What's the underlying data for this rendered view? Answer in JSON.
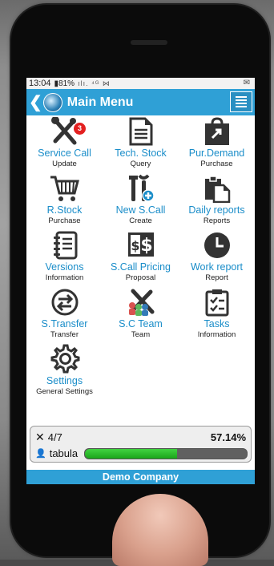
{
  "status_bar": {
    "time": "13:04",
    "battery": "81%",
    "signal_icons": "ılı. ⁴ᴳ ⋈",
    "mail_icon": "mail-icon"
  },
  "header": {
    "title": "Main Menu",
    "back_icon": "back-chevron-icon",
    "logo_icon": "globe-icon",
    "menu_icon": "menu-icon",
    "color": "#2fa0d6"
  },
  "tiles": [
    {
      "label": "Service Call",
      "sub": "Update",
      "icon": "tools-icon",
      "badge": "3"
    },
    {
      "label": "Tech. Stock",
      "sub": "Query",
      "icon": "document-icon"
    },
    {
      "label": "Pur.Demand",
      "sub": "Purchase",
      "icon": "shopping-bag-icon"
    },
    {
      "label": "R.Stock",
      "sub": "Purchase",
      "icon": "cart-icon"
    },
    {
      "label": "New S.Call",
      "sub": "Create",
      "icon": "new-tools-icon"
    },
    {
      "label": "Daily reports",
      "sub": "Reports",
      "icon": "clipboard-copy-icon"
    },
    {
      "label": "Versions",
      "sub": "Information",
      "icon": "notebook-icon"
    },
    {
      "label": "S.Call Pricing",
      "sub": "Proposal",
      "icon": "pricing-icon"
    },
    {
      "label": "Work report",
      "sub": "Report",
      "icon": "clock-icon"
    },
    {
      "label": "S.Transfer",
      "sub": "Transfer",
      "icon": "transfer-icon"
    },
    {
      "label": "S.C Team",
      "sub": "Team",
      "icon": "team-icon"
    },
    {
      "label": "Tasks",
      "sub": "Information",
      "icon": "tasks-clipboard-icon"
    },
    {
      "label": "Settings",
      "sub": "General Settings",
      "icon": "gear-icon"
    }
  ],
  "progress": {
    "count": "4/7",
    "percent": "57.14%",
    "fraction": 0.5714,
    "user": "tabula",
    "tools_icon": "tools-icon",
    "user_icon": "user-icon"
  },
  "footer": {
    "company": "Demo Company"
  }
}
